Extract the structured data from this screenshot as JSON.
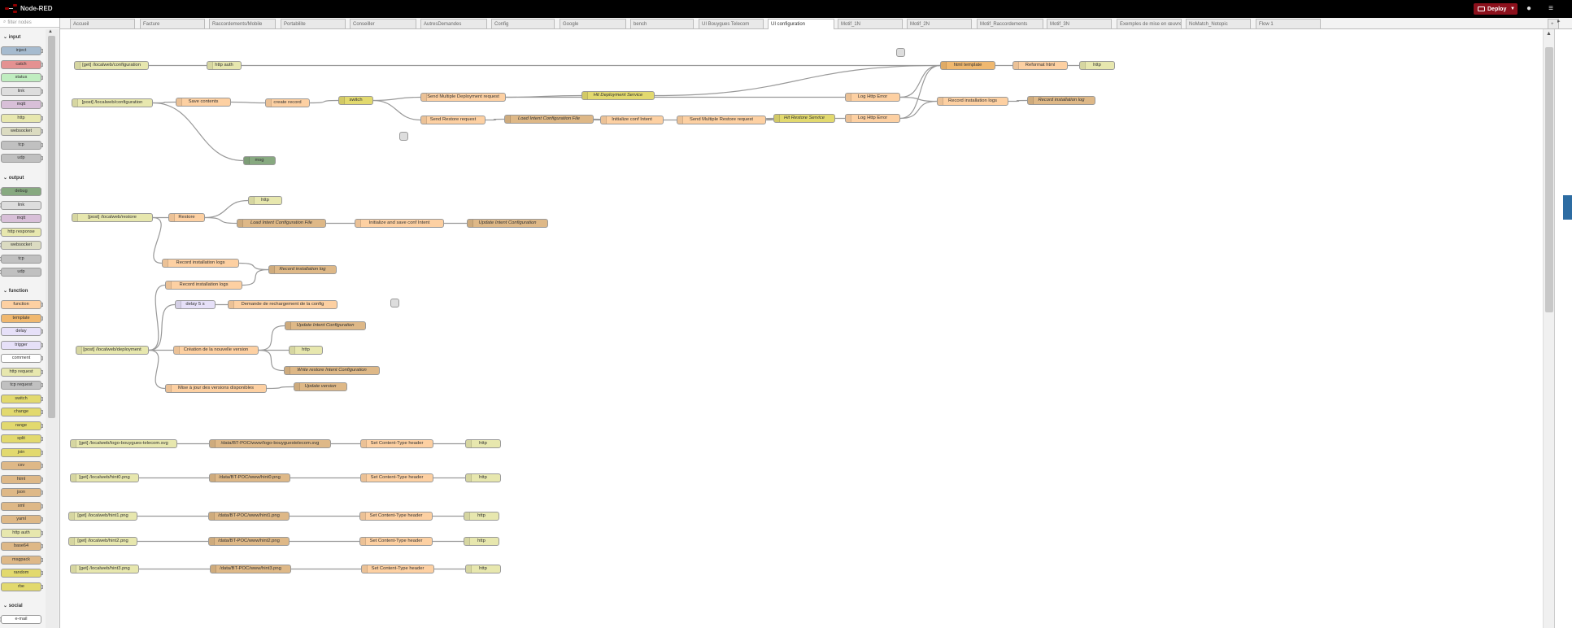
{
  "header": {
    "title": "Node-RED",
    "deploy_label": "Deploy"
  },
  "palette": {
    "filter_placeholder": "filter nodes",
    "categories": {
      "input": "input",
      "output": "output",
      "function": "function",
      "social": "social"
    },
    "input_nodes": [
      "inject",
      "catch",
      "status",
      "link",
      "mqtt",
      "http",
      "websocket",
      "tcp",
      "udp"
    ],
    "output_nodes": [
      "debug",
      "link",
      "mqtt",
      "http response",
      "websocket",
      "tcp",
      "udp"
    ],
    "function_nodes": [
      "function",
      "template",
      "delay",
      "trigger",
      "comment",
      "http request",
      "tcp request",
      "switch",
      "change",
      "range",
      "split",
      "join",
      "csv",
      "html",
      "json",
      "xml",
      "yaml",
      "http auth",
      "base64",
      "msgpack",
      "random",
      "rbe"
    ],
    "social_nodes": [
      "e-mail"
    ]
  },
  "tabs": [
    "Accueil",
    "Facture",
    "Raccordements/Mobile",
    "Portabilite",
    "Conseiller",
    "AutresDemandes",
    "Config",
    "Google",
    "bench",
    "UI Bouygues Telecom",
    "UI configuration",
    "Motif_1N",
    "Motif_2N",
    "Motif_Raccordements",
    "Motif_3N",
    "Exemples de mise en œuvre",
    "NoMatch_Notopic",
    "Flow 1"
  ],
  "active_tab": "UI configuration",
  "nodes": {
    "n1": "[get] /localweb/configuration",
    "n2": "http auth",
    "n3": "html template",
    "n4": "Reformat html",
    "n5": "http",
    "n6": "[post] /localweb/configuration",
    "n7": "Save contents",
    "n8": "create record",
    "n9": "switch",
    "n10": "Send Multiple Deployment request",
    "n11": "Hit Deployment Service",
    "n12": "Log Http Error",
    "n13": "Record installation logs",
    "n14": "Record installation log",
    "n15": "Send Restore request",
    "n16": "Load Intent Configuration File",
    "n17": "Initialize conf Intent",
    "n18": "Send Multiple Restore request",
    "n19": "Hit Restore Service",
    "n20": "Log Http Error",
    "n21": "msg",
    "n22": "[post] /localweb/restore",
    "n23": "Restore",
    "n24": "http",
    "n25": "Load Intent Configuration File",
    "n26": "Initialize and save conf Intent",
    "n27": "Update Intent Configuration",
    "n28": "Record installation logs",
    "n29": "Record installation log",
    "n30": "Record installation logs",
    "n31": "delay 5 s",
    "n32": "Demande de rechargement de la config",
    "n33": "[post] /localweb/deployment",
    "n34": "Update Intent Configuration",
    "n35": "Création de la nouvelle version",
    "n36": "http",
    "n37": "Write restore Intent Configuration",
    "n38": "Mise à jour des versions disponibles",
    "n39": "Update version",
    "n40": "[get] /localweb/logo-bouygues-telecom.svg",
    "n41": "/data/BT-POC/www/logo-bouyguestelecom.svg",
    "n42": "Set Content-Type header",
    "n43": "http",
    "n44": "[get] /localweb/hint0.png",
    "n45": "/data/BT-POC/www/hint0.png",
    "n46": "Set Content-Type header",
    "n47": "http",
    "n48": "[get] /localweb/hint1.png",
    "n49": "/data/BT-POC/www/hint1.png",
    "n50": "Set Content-Type header",
    "n51": "http",
    "n52": "[get] /localweb/hint2.png",
    "n53": "/data/BT-POC/www/hint2.png",
    "n54": "Set Content-Type header",
    "n55": "http",
    "n56": "[get] /localweb/hint3.png",
    "n57": "/data/BT-POC/www/hint3.png",
    "n58": "Set Content-Type header",
    "n59": "http"
  },
  "colors": {
    "http_in": "#e7e7ae",
    "function": "#fdd0a2",
    "template": "#f0b86f",
    "file": "#deb887",
    "switch": "#e2d96e",
    "delay": "#e6e0f8",
    "debug": "#87a980",
    "deploy": "#8c101c",
    "link": "#dddddd"
  }
}
